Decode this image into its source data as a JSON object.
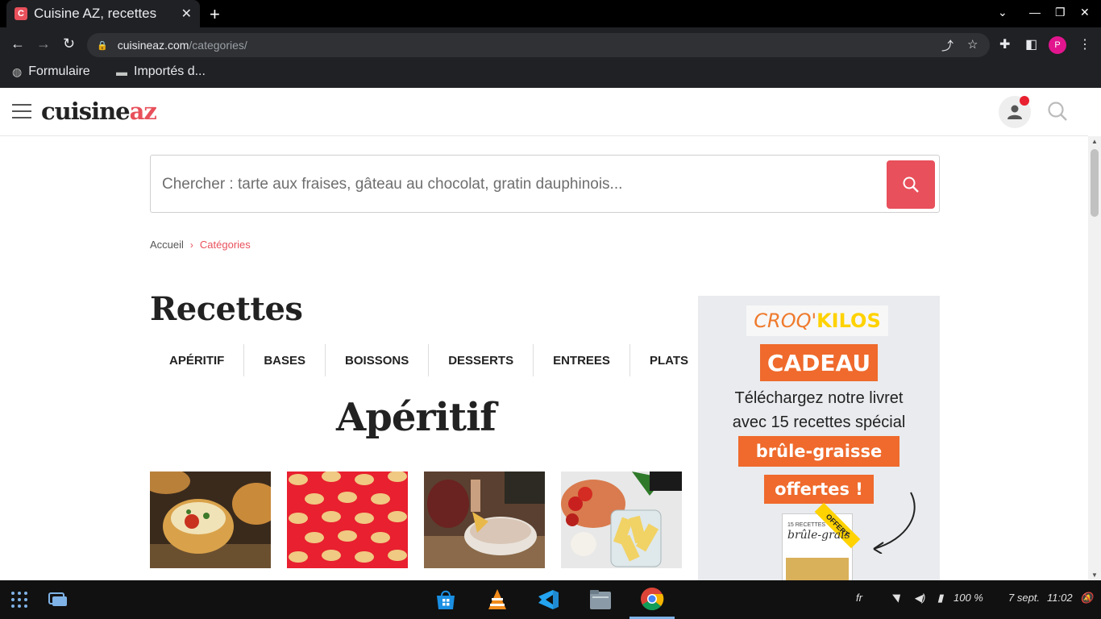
{
  "browser": {
    "tab_title": "Cuisine AZ, recettes",
    "favicon_letter": "C",
    "url_host": "cuisineaz.com",
    "url_path": "/categories/",
    "profile_initial": "P",
    "bookmarks": [
      {
        "label": "Formulaire",
        "icon": "globe-icon"
      },
      {
        "label": "Importés d...",
        "icon": "folder-icon"
      }
    ]
  },
  "site": {
    "logo_main": "cuisine",
    "logo_accent": "az",
    "accent_color": "#e8505b",
    "search_placeholder": "Chercher : tarte aux fraises, gâteau au chocolat, gratin dauphinois...",
    "breadcrumb": {
      "home": "Accueil",
      "current": "Catégories"
    },
    "page_title": "Recettes",
    "categories": [
      "APÉRITIF",
      "BASES",
      "BOISSONS",
      "DESSERTS",
      "ENTREES",
      "PLATS"
    ],
    "section_title": "Apéritif"
  },
  "ad": {
    "brand_part1": "CROQ'",
    "brand_part2": "KILOS",
    "cadeau": "CADEAU",
    "line1": "Téléchargez notre livret",
    "line2": "avec 15 recettes spécial",
    "tag1": "brûle-graisse",
    "tag2": "offertes !",
    "book_small": "15 RECETTES",
    "book_title": "brûle-grais",
    "book_badge": "OFFERT"
  },
  "taskbar": {
    "language": "fr",
    "battery": "100 %",
    "date": "7 sept.",
    "time": "11:02"
  }
}
